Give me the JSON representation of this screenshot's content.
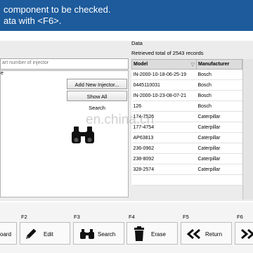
{
  "banner": {
    "line1": "component to be checked.",
    "line2": "ata with <F6>."
  },
  "left": {
    "search_placeholder": "art number of injector",
    "list_top_text": "e",
    "buttons": {
      "add_new": "Add New Injector...",
      "show_all": "Show All",
      "search": "Search"
    }
  },
  "data_panel": {
    "label": "Data",
    "records_text": "Retrieved total of 2543 records",
    "columns": [
      "Model",
      "Manufacturer"
    ],
    "rows": [
      {
        "model": "IN-2000-10-18-06-25-19",
        "manufacturer": "Bosch"
      },
      {
        "model": "0445110031",
        "manufacturer": "Bosch"
      },
      {
        "model": "IN-2000-10-23-08-07-21",
        "manufacturer": "Bosch"
      },
      {
        "model": "126",
        "manufacturer": "Bosch"
      },
      {
        "model": "174-7526",
        "manufacturer": "Caterpillar"
      },
      {
        "model": "177-4754",
        "manufacturer": "Caterpillar"
      },
      {
        "model": "AP63813",
        "manufacturer": "Caterpillar"
      },
      {
        "model": "236-0962",
        "manufacturer": "Caterpillar"
      },
      {
        "model": "238-8092",
        "manufacturer": "Caterpillar"
      },
      {
        "model": "328-2574",
        "manufacturer": "Caterpillar"
      },
      {
        "model": "",
        "manufacturer": ""
      }
    ]
  },
  "watermark": "en.china.cn",
  "toolbar": {
    "fkeys": [
      "F2",
      "F3",
      "F4",
      "F5",
      "F6"
    ],
    "buttons": {
      "clipboard": "oard",
      "edit": "Edit",
      "search": "Search",
      "erase": "Erase",
      "return": "Return"
    }
  },
  "icons": [
    "binoculars-icon",
    "pencil-icon",
    "trash-icon",
    "double-left-arrow-icon",
    "double-right-arrow-icon"
  ]
}
